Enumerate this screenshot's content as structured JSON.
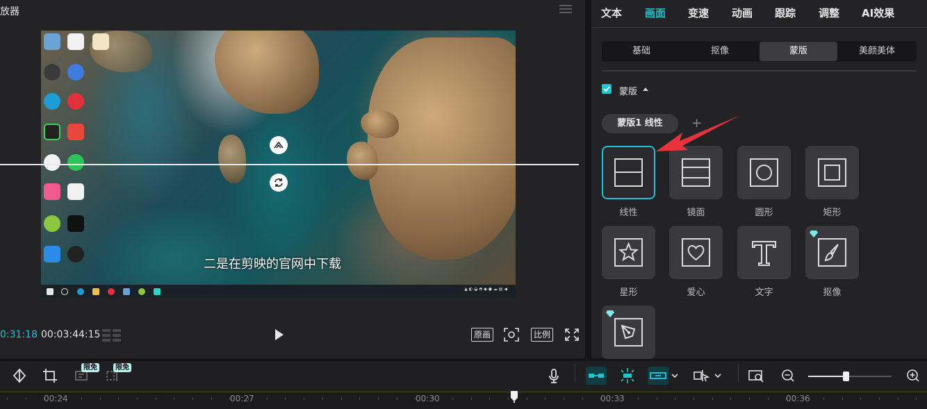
{
  "player": {
    "title": "放器",
    "current_time": "0:31:18",
    "total_time": "00:03:44:15",
    "subtitle": "二是在剪映的官网中下载",
    "original_label": "原画",
    "ratio_label": "比例"
  },
  "panel": {
    "tabs": [
      "文本",
      "画面",
      "变速",
      "动画",
      "跟踪",
      "调整",
      "AI效果"
    ],
    "active_tab": "画面",
    "subtabs": [
      "基础",
      "抠像",
      "蒙版",
      "美颜美体"
    ],
    "active_subtab": "蒙版",
    "mask_section_label": "蒙版",
    "mask_chip": "蒙版1 线性",
    "add_label": "+",
    "masks": [
      {
        "label": "线性",
        "icon": "linear-mask-icon"
      },
      {
        "label": "镜面",
        "icon": "mirror-mask-icon"
      },
      {
        "label": "圆形",
        "icon": "circle-mask-icon"
      },
      {
        "label": "矩形",
        "icon": "rectangle-mask-icon"
      },
      {
        "label": "星形",
        "icon": "star-mask-icon"
      },
      {
        "label": "爱心",
        "icon": "heart-mask-icon"
      },
      {
        "label": "文字",
        "icon": "text-mask-icon"
      },
      {
        "label": "抠像",
        "icon": "cutout-mask-icon"
      },
      {
        "label": "",
        "icon": "pen-mask-icon"
      }
    ]
  },
  "toolbar": {
    "badge1": "限免",
    "badge2": "限免",
    "zoom_level": 0.45
  },
  "ruler": {
    "labels": [
      "00:24",
      "00:27",
      "00:30",
      "00:33",
      "00:36"
    ]
  },
  "colors": {
    "accent": "#22c3cf",
    "arrow": "#e8323c"
  }
}
